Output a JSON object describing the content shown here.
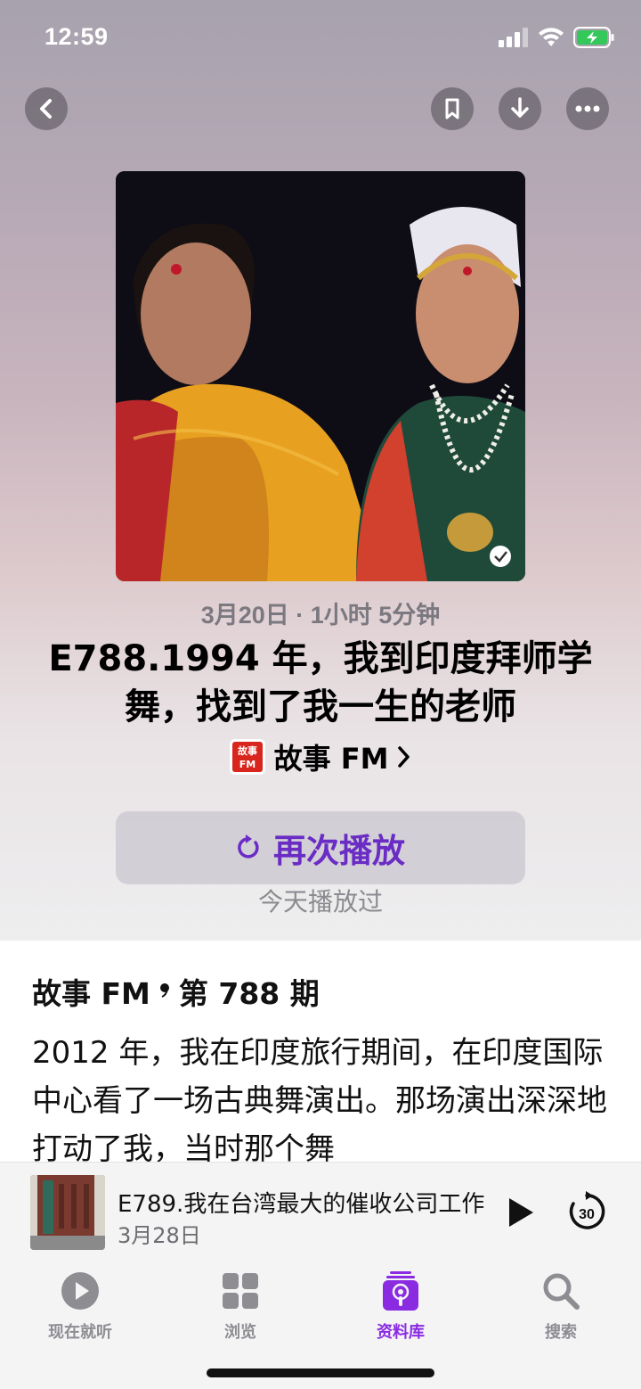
{
  "status_bar": {
    "time": "12:59"
  },
  "episode": {
    "meta": "3月20日 · 1小时 5分钟",
    "title": "E788.1994 年，我到印度拜师学舞，找到了我一生的老师",
    "show_name": "故事 FM",
    "show_logo_text": "故事FM",
    "play_again_label": "再次播放",
    "played_note": "今天播放过",
    "info_show": "故事 FM",
    "info_episode": "第 788 期",
    "description": "2012 年，我在印度旅行期间，在印度国际中心看了一场古典舞演出。那场演出深深地打动了我，当时那个舞"
  },
  "mini_player": {
    "title": "E789.我在台湾最大的催收公司工作",
    "date": "3月28日",
    "skip_seconds": "30"
  },
  "tabs": [
    {
      "label": "现在就听",
      "icon": "play-circle-icon",
      "active": false
    },
    {
      "label": "浏览",
      "icon": "grid-icon",
      "active": false
    },
    {
      "label": "资料库",
      "icon": "podcast-library-icon",
      "active": true
    },
    {
      "label": "搜索",
      "icon": "search-icon",
      "active": false
    }
  ],
  "colors": {
    "accent": "#8a2be2",
    "play_again_text": "#6a2cc4"
  }
}
